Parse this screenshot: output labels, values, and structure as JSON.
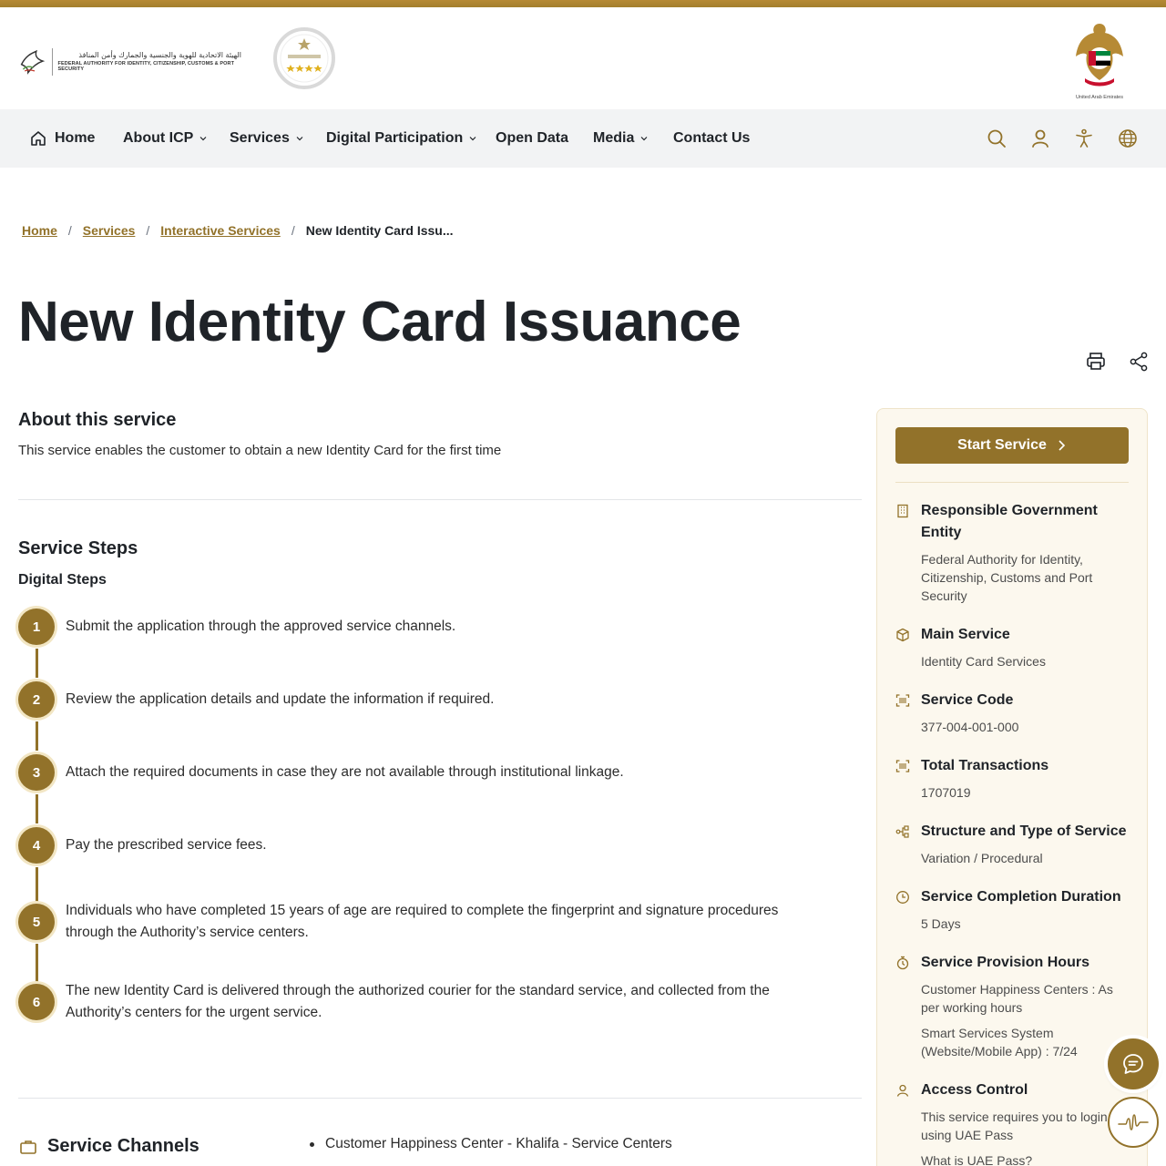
{
  "header": {
    "logo_arabic": "الهيئة الاتحادية للهوية والجنسية والجمارك وأمن المنافذ",
    "logo_english": "FEDERAL AUTHORITY FOR IDENTITY, CITIZENSHIP, CUSTOMS & PORT SECURITY",
    "emblem_caption": "United Arab Emirates"
  },
  "nav": {
    "items": [
      {
        "label": "Home"
      },
      {
        "label": "About ICP"
      },
      {
        "label": "Services"
      },
      {
        "label": "Digital Participation"
      },
      {
        "label": "Open Data"
      },
      {
        "label": "Media"
      },
      {
        "label": "Contact Us"
      }
    ]
  },
  "breadcrumb": {
    "items": [
      "Home",
      "Services",
      "Interactive Services"
    ],
    "separator": "/",
    "current": "New Identity Card Issu..."
  },
  "page": {
    "title": "New Identity Card Issuance",
    "about_heading": "About this service",
    "about_text": "This service enables the customer to obtain a new Identity Card for the first time",
    "steps_heading": "Service Steps",
    "steps_subheading": "Digital Steps",
    "steps": [
      {
        "num": "1",
        "text": "Submit the application through the approved service channels."
      },
      {
        "num": "2",
        "text": "Review the application details and update the information if required."
      },
      {
        "num": "3",
        "text": "Attach the required documents in case they are not available through institutional linkage."
      },
      {
        "num": "4",
        "text": "Pay the prescribed service fees."
      },
      {
        "num": "5",
        "text": "Individuals who have completed 15 years of age are required to complete the fingerprint and signature procedures through the Authority’s service centers."
      },
      {
        "num": "6",
        "text": "The new Identity Card is delivered through the authorized courier for the standard service, and collected from the Authority’s centers for the urgent service."
      }
    ],
    "channels_heading": "Service Channels",
    "channels": [
      "Customer Happiness Center - Khalifa - Service Centers"
    ]
  },
  "sidebar": {
    "start_label": "Start Service",
    "responsible_h": "Responsible Government Entity",
    "responsible_v": "Federal Authority for Identity, Citizenship, Customs and Port Security",
    "main_h": "Main Service",
    "main_v": "Identity Card Services",
    "code_h": "Service Code",
    "code_v": "377-004-001-000",
    "trans_h": "Total Transactions",
    "trans_v": "1707019",
    "struct_h": "Structure and Type of Service",
    "struct_v": "Variation / Procedural",
    "dur_h": "Service Completion Duration",
    "dur_v": "5 Days",
    "hours_h": "Service Provision Hours",
    "hours_v1": "Customer Happiness Centers : As per working hours",
    "hours_v2": "Smart Services System (Website/Mobile App) : 7/24",
    "access_h": "Access Control",
    "access_v": "This service requires you to login using UAE Pass",
    "access_link": "What is UAE Pass?"
  },
  "colors": {
    "accent": "#92722a",
    "nav_bg": "#f2f3f4",
    "sidebar_bg": "#fcf8ee"
  }
}
